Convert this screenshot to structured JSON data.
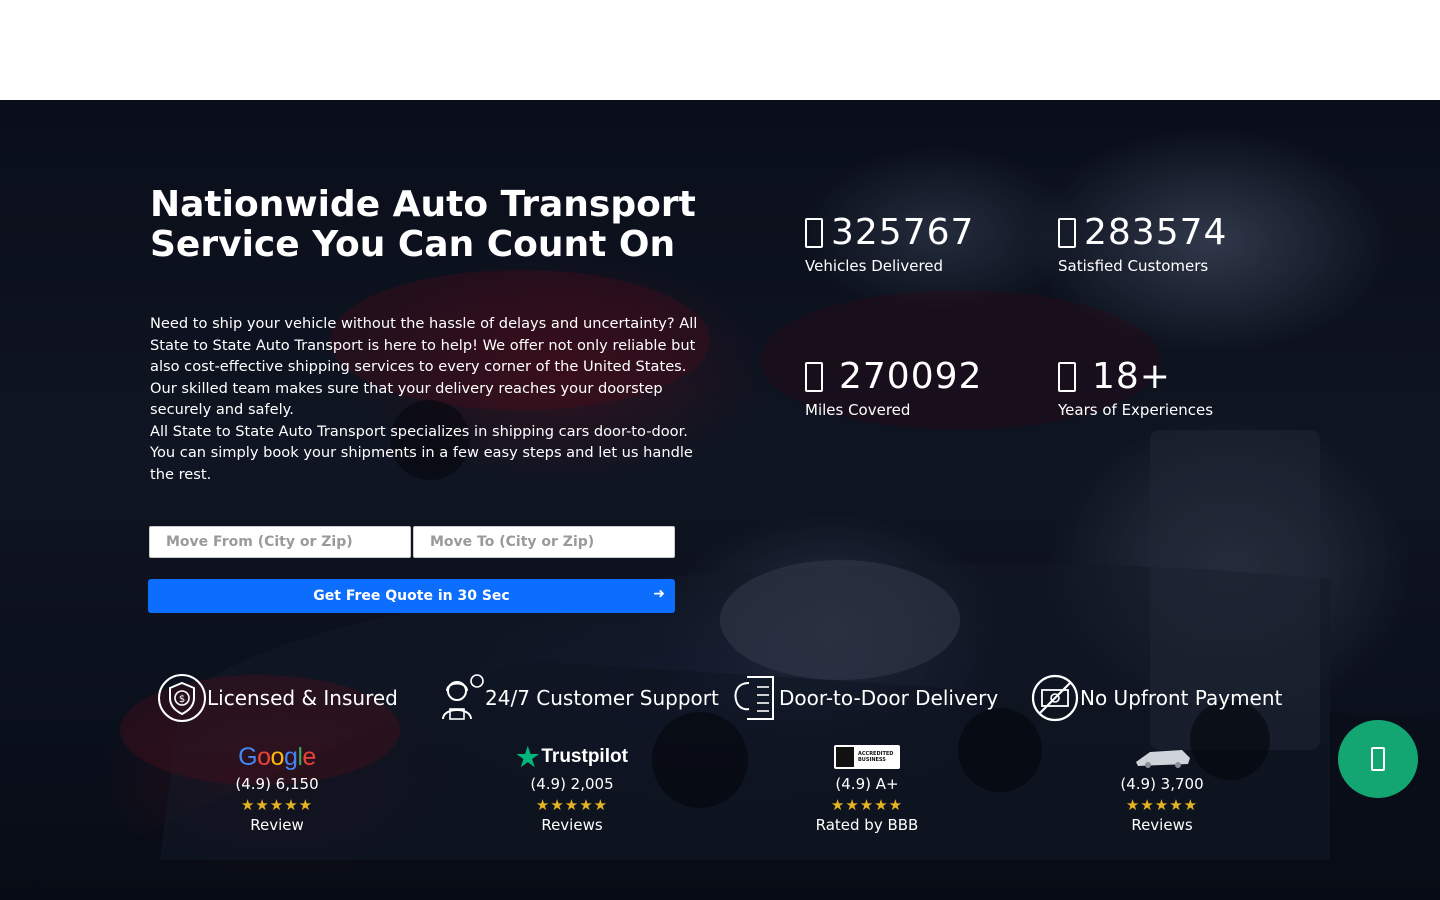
{
  "hero": {
    "title": "Nationwide Auto Transport Service You Can Count On",
    "description_1": "Need to ship your vehicle without the hassle of delays and uncertainty? All State to State Auto Transport is here to help! We offer not only reliable but also cost-effective shipping services to every corner of the United States. Our skilled team makes sure that your delivery reaches your doorstep securely and safely.",
    "description_2": "All State to State Auto Transport specializes in shipping cars door-to-door. You can simply book your shipments in a few easy steps and let us handle the rest."
  },
  "form": {
    "from_placeholder": "Move From (City or Zip)",
    "to_placeholder": "Move To (City or Zip)",
    "submit_label": "Get Free Quote in 30 Sec"
  },
  "stats": [
    {
      "value": "325767",
      "label": "Vehicles Delivered"
    },
    {
      "value": "283574",
      "label": "Satisfied Customers"
    },
    {
      "value": "270092",
      "label": "Miles Covered"
    },
    {
      "value": "18+",
      "label": "Years of Experiences"
    }
  ],
  "features": [
    {
      "label": "Licensed & Insured",
      "icon": "shield-dollar-icon"
    },
    {
      "label": "24/7 Customer Support",
      "icon": "support-agent-icon"
    },
    {
      "label": "Door-to-Door Delivery",
      "icon": "door-delivery-icon"
    },
    {
      "label": "No Upfront Payment",
      "icon": "no-cash-icon"
    }
  ],
  "reviews": [
    {
      "platform": "Google",
      "score": "(4.9) 6,150",
      "stars": "★★★★★",
      "label": "Review"
    },
    {
      "platform": "Trustpilot",
      "score": "(4.9) 2,005",
      "stars": "★★★★★",
      "label": "Reviews"
    },
    {
      "platform": "BBB",
      "badge_line_1": "ACCREDITED",
      "badge_line_2": "BUSINESS",
      "score": "(4.9) A+",
      "stars": "★★★★★",
      "label": "Rated by BBB"
    },
    {
      "platform": "TransportReviews",
      "score": "(4.9) 3,700",
      "stars": "★★★★★",
      "label": "Reviews"
    }
  ],
  "colors": {
    "primary_button": "#0d6efd",
    "chat_button": "#13a672",
    "star": "#e6b322",
    "trustpilot": "#00b67a"
  },
  "chat": {
    "icon": "phone-icon"
  }
}
